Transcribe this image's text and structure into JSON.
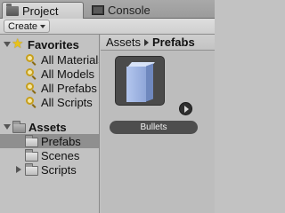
{
  "tabs": {
    "project": {
      "label": "Project",
      "icon": "folder-icon"
    },
    "console": {
      "label": "Console",
      "icon": "console-icon"
    }
  },
  "toolbar": {
    "create_label": "Create"
  },
  "favorites": {
    "label": "Favorites",
    "items": [
      {
        "label": "All Materials",
        "icon": "search-icon"
      },
      {
        "label": "All Models",
        "icon": "search-icon"
      },
      {
        "label": "All Prefabs",
        "icon": "search-icon"
      },
      {
        "label": "All Scripts",
        "icon": "search-icon"
      }
    ]
  },
  "assets": {
    "label": "Assets",
    "children": [
      {
        "label": "Prefabs",
        "selected": true
      },
      {
        "label": "Scenes",
        "selected": false
      },
      {
        "label": "Scripts",
        "selected": false,
        "collapsed": true
      }
    ]
  },
  "breadcrumb": {
    "root": "Assets",
    "current": "Prefabs"
  },
  "content": {
    "items": [
      {
        "label": "Bullets",
        "type": "prefab"
      }
    ]
  },
  "colors": {
    "panel_bg": "#c2c2c2",
    "selection_bg": "#8f8f8f",
    "favorite_star": "#e9c219",
    "prefab_cube": "#9fb4e4"
  }
}
